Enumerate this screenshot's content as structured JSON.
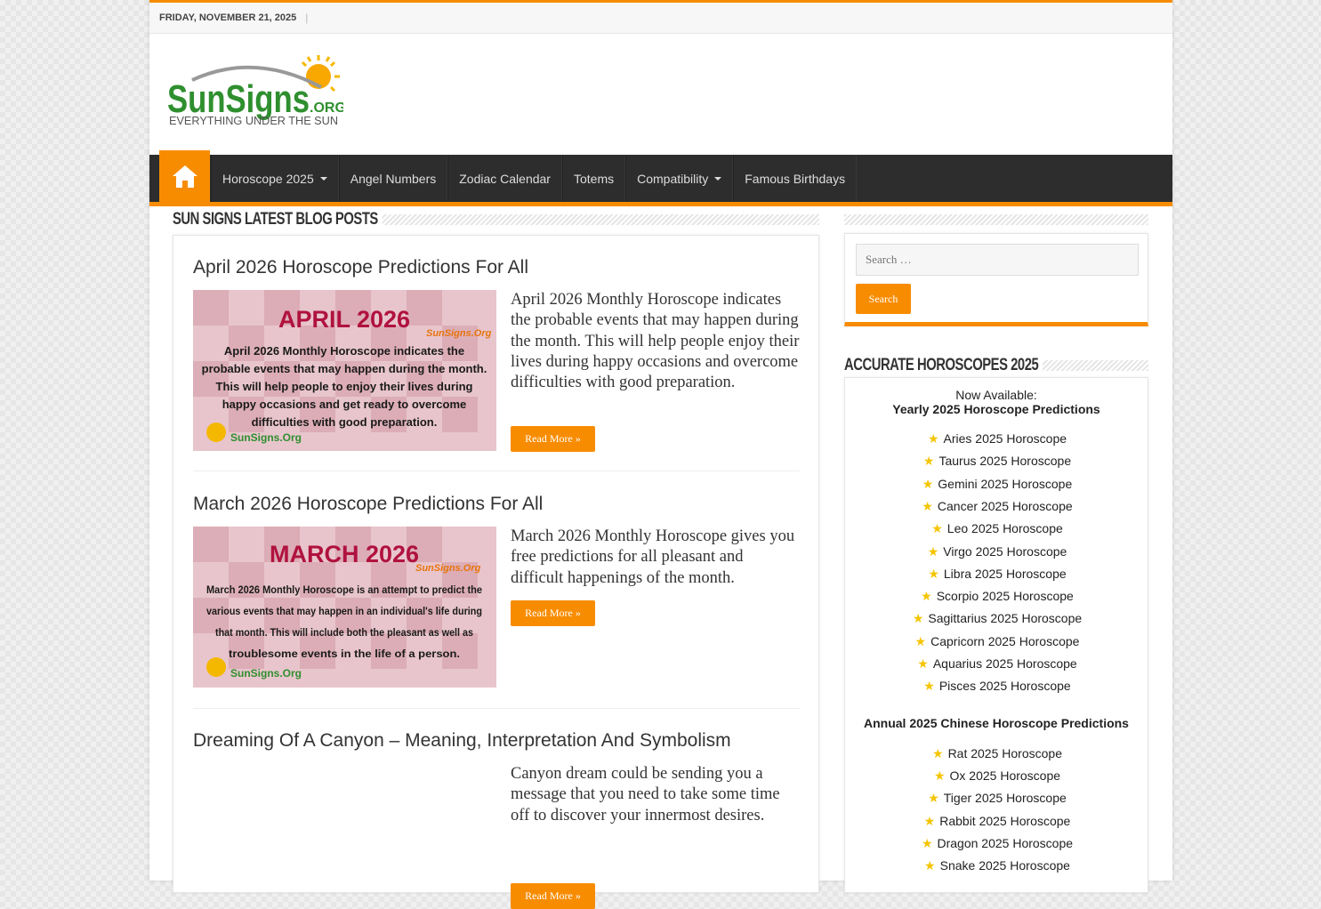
{
  "topbar": {
    "date": "FRIDAY, NOVEMBER 21, 2025",
    "separator": "|"
  },
  "logo": {
    "text_main": "SUN SIGNS",
    "text_suffix": ".ORG",
    "tagline": "EVERYTHING UNDER THE SUN"
  },
  "nav": {
    "home_icon": "home-icon",
    "items": [
      {
        "label": "Horoscope 2025",
        "has_dropdown": true
      },
      {
        "label": "Angel Numbers",
        "has_dropdown": false
      },
      {
        "label": "Zodiac Calendar",
        "has_dropdown": false
      },
      {
        "label": "Totems",
        "has_dropdown": false
      },
      {
        "label": "Compatibility",
        "has_dropdown": true
      },
      {
        "label": "Famous Birthdays",
        "has_dropdown": false
      }
    ]
  },
  "main": {
    "section_title": "Sun Signs Latest Blog Posts",
    "posts": [
      {
        "title": "April 2026 Horoscope Predictions For All",
        "excerpt": "April 2026 Monthly Horoscope indicates the probable events that may happen during the month. This will help people enjoy their lives during happy occasions and overcome difficulties with good preparation.",
        "read_more": "Read More »",
        "thumb": {
          "heading": "APRIL 2026",
          "brand": "SunSigns.Org",
          "lines": [
            "April 2026 Monthly Horoscope indicates the",
            "probable events that may happen during the month.",
            "This will help people to enjoy their lives during",
            "happy occasions and get ready to overcome",
            "difficulties with good preparation."
          ]
        }
      },
      {
        "title": "March 2026 Horoscope Predictions For All",
        "excerpt": "March 2026 Monthly Horoscope gives you free predictions for all pleasant and difficult happenings of the month.",
        "read_more": "Read More »",
        "thumb": {
          "heading": "MARCH 2026",
          "brand": "SunSigns.Org",
          "lines": [
            "March 2026 Monthly Horoscope is an attempt to predict the",
            "various events that may happen in an individual's life during",
            "that month. This will include both the pleasant as well as",
            "troublesome events in the life of a person."
          ]
        }
      },
      {
        "title": "Dreaming Of A Canyon – Meaning, Interpretation And Symbolism",
        "excerpt": "Canyon dream could be sending you a message that you need to take some time off to discover your innermost desires.",
        "read_more": "Read More »"
      }
    ]
  },
  "sidebar": {
    "search": {
      "placeholder": "Search …",
      "button": "Search"
    },
    "horoscopes": {
      "title": "Accurate Horoscopes 2025",
      "now_available": "Now Available:",
      "yearly_title": "Yearly 2025 Horoscope Predictions",
      "yearly_items": [
        "Aries 2025 Horoscope",
        "Taurus 2025 Horoscope",
        "Gemini 2025 Horoscope",
        "Cancer 2025 Horoscope",
        "Leo 2025 Horoscope",
        "Virgo 2025 Horoscope",
        "Libra 2025 Horoscope",
        "Scorpio 2025 Horoscope",
        "Sagittarius 2025 Horoscope",
        "Capricorn 2025 Horoscope",
        "Aquarius 2025 Horoscope",
        "Pisces 2025 Horoscope"
      ],
      "chinese_title": "Annual 2025 Chinese Horoscope Predictions",
      "chinese_items": [
        "Rat 2025 Horoscope",
        "Ox 2025 Horoscope",
        "Tiger 2025 Horoscope",
        "Rabbit 2025 Horoscope",
        "Dragon 2025 Horoscope",
        "Snake 2025 Horoscope"
      ]
    }
  },
  "colors": {
    "accent": "#f88c00",
    "nav_bg": "#2d2d2d",
    "star": "#f5c400"
  }
}
